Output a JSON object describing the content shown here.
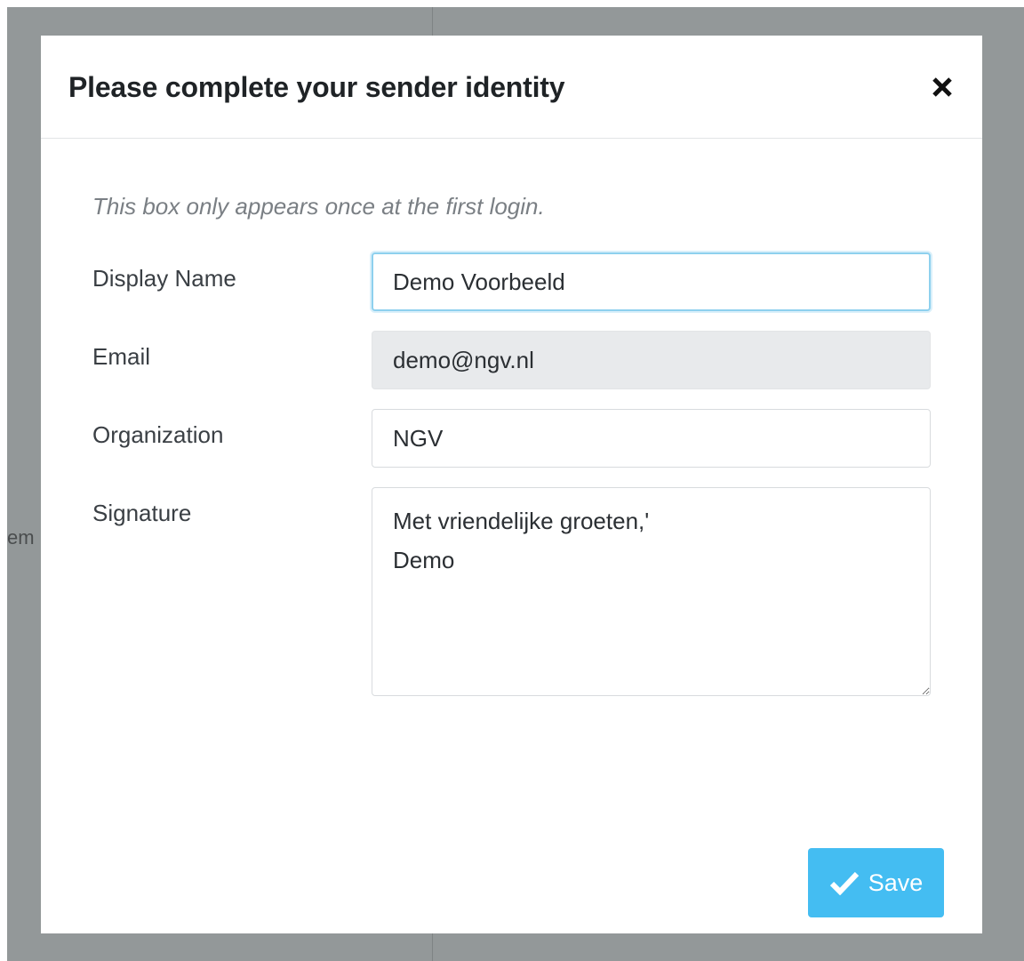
{
  "background": {
    "partial_text": "em"
  },
  "modal": {
    "title": "Please complete your sender identity",
    "close_icon": "close-icon",
    "intro": "This box only appears once at the first login.",
    "fields": {
      "display_name": {
        "label": "Display Name",
        "value": "Demo Voorbeeld"
      },
      "email": {
        "label": "Email",
        "value": "demo@ngv.nl"
      },
      "organization": {
        "label": "Organization",
        "value": "NGV"
      },
      "signature": {
        "label": "Signature",
        "value": "Met vriendelijke groeten,'\nDemo"
      }
    },
    "save_button": {
      "label": "Save",
      "icon": "checkmark-icon"
    }
  },
  "colors": {
    "backdrop": "#939899",
    "accent": "#44bdf2",
    "focus_border": "#8ed0ee",
    "readonly_bg": "#e8eaec"
  }
}
